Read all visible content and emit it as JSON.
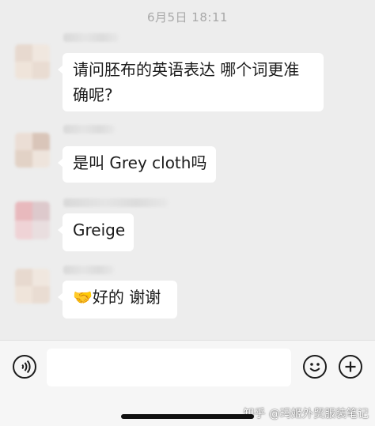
{
  "timestamp": "6月5日 18:11",
  "messages": [
    {
      "lines": [
        "请问胚布的英语表达 哪个词更准",
        "确呢?"
      ]
    },
    {
      "lines": [
        "是叫 Grey cloth吗"
      ]
    },
    {
      "lines": [
        "Greige"
      ]
    },
    {
      "lines": [
        "好的 谢谢"
      ],
      "emoji": "🤝",
      "emoji_name": "handshake-emoji"
    }
  ],
  "input_bar": {
    "voice_button": "voice-icon",
    "emoji_button": "smiley-icon",
    "more_button": "plus-icon",
    "input_value": ""
  },
  "watermark": "知乎 @玛姬外贸服装笔记",
  "colors": {
    "chat_background": "#ededed",
    "bubble": "#ffffff",
    "input_bar": "#f6f6f6",
    "timestamp": "#a8a8a8"
  }
}
